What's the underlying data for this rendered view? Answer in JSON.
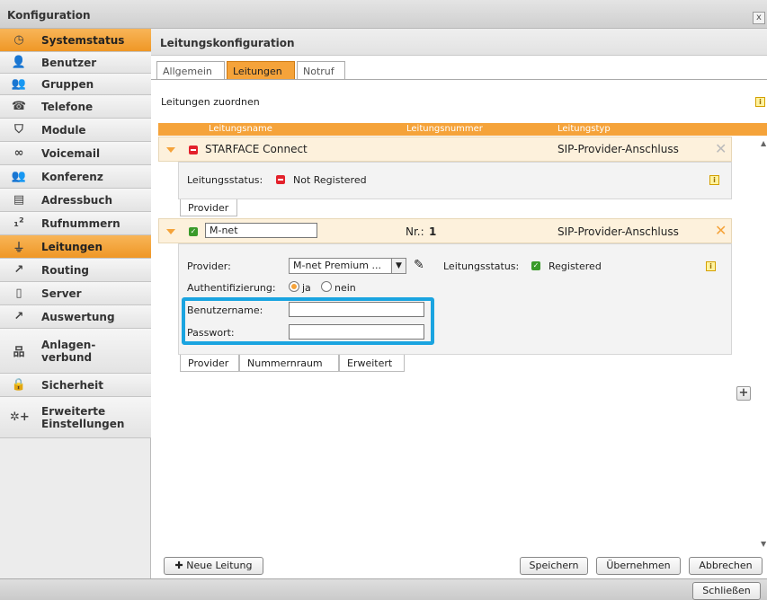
{
  "window": {
    "title": "Konfiguration",
    "close_label": "x"
  },
  "sidebar": {
    "items": [
      {
        "label": "Systemstatus",
        "icon": "clock-icon",
        "glyph": "◷",
        "active": true
      },
      {
        "label": "Benutzer",
        "icon": "user-icon",
        "glyph": "👤"
      },
      {
        "label": "Gruppen",
        "icon": "group-icon",
        "glyph": "👥"
      },
      {
        "label": "Telefone",
        "icon": "phone-icon",
        "glyph": "☎"
      },
      {
        "label": "Module",
        "icon": "shield-icon",
        "glyph": "⛉"
      },
      {
        "label": "Voicemail",
        "icon": "voicemail-icon",
        "glyph": "∞"
      },
      {
        "label": "Konferenz",
        "icon": "conference-icon",
        "glyph": "👥"
      },
      {
        "label": "Adressbuch",
        "icon": "addressbook-icon",
        "glyph": "▤"
      },
      {
        "label": "Rufnummern",
        "icon": "numbers-icon",
        "glyph": "₁²"
      },
      {
        "label": "Leitungen",
        "icon": "plug-icon",
        "glyph": "⏚",
        "active": true
      },
      {
        "label": "Routing",
        "icon": "routing-icon",
        "glyph": "↗"
      },
      {
        "label": "Server",
        "icon": "server-icon",
        "glyph": "▯"
      },
      {
        "label": "Auswertung",
        "icon": "chart-icon",
        "glyph": "↗"
      },
      {
        "label": "Anlagen-\nverbund",
        "icon": "network-icon",
        "glyph": "品"
      },
      {
        "label": "Sicherheit",
        "icon": "lock-icon",
        "glyph": "🔒"
      },
      {
        "label": "Erweiterte\nEinstellungen",
        "icon": "advanced-settings-icon",
        "glyph": "✲+"
      }
    ]
  },
  "content": {
    "header": "Leitungskonfiguration",
    "tabs": [
      "Allgemein",
      "Leitungen",
      "Notruf"
    ],
    "section_title": "Leitungen zuordnen",
    "info_glyph": "i",
    "columns": [
      "Leitungsname",
      "Leitungsnummer",
      "Leitungstyp"
    ],
    "line1": {
      "name": "STARFACE Connect",
      "type": "SIP-Provider-Anschluss",
      "status_label": "Leitungsstatus:",
      "status_value": "Not Registered",
      "subtab": "Provider"
    },
    "line2": {
      "name": "M-net",
      "number_label": "Nr.:",
      "number_value": "1",
      "type": "SIP-Provider-Anschluss",
      "provider_label": "Provider:",
      "provider_value": "M-net Premium ...",
      "status_label": "Leitungsstatus:",
      "status_value": "Registered",
      "auth_label": "Authentifizierung:",
      "auth_yes": "ja",
      "auth_no": "nein",
      "username_label": "Benutzername:",
      "username_value": "",
      "password_label": "Passwort:",
      "password_value": "",
      "subtabs": [
        "Provider",
        "Nummernraum",
        "Erweitert"
      ]
    },
    "buttons": {
      "new_line": "Neue Leitung",
      "save": "Speichern",
      "apply": "Übernehmen",
      "cancel": "Abbrechen"
    }
  },
  "statusbar": {
    "close_button": "Schließen"
  },
  "colors": {
    "accent": "#f5a33a",
    "highlight": "#1aa4e0",
    "status_red": "#e3212b",
    "status_green": "#3a9a2a"
  }
}
